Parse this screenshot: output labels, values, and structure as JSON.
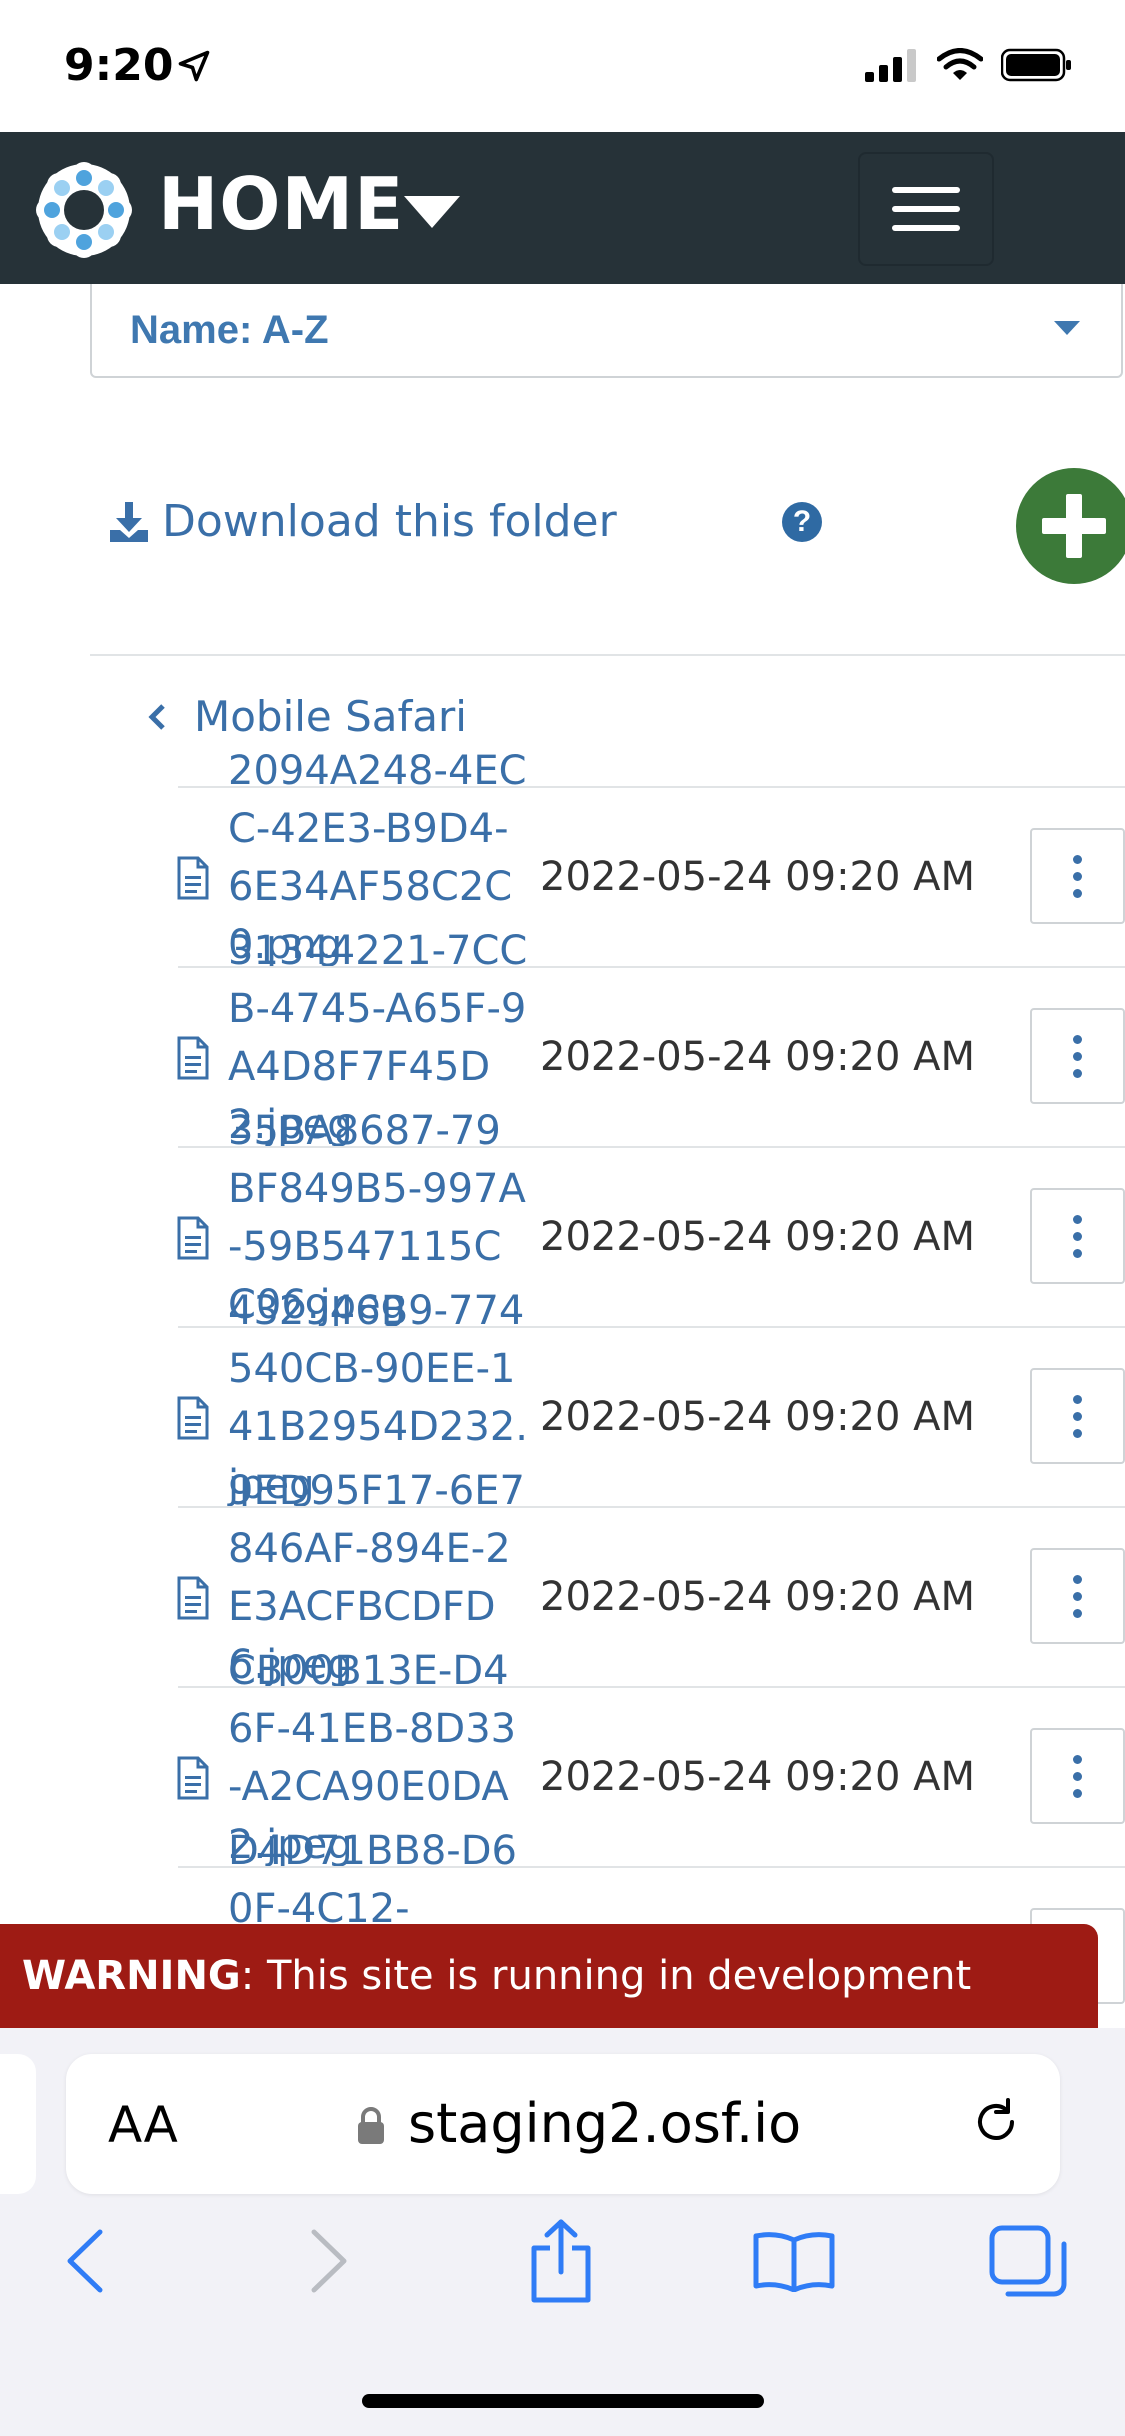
{
  "status_bar": {
    "time": "9:20"
  },
  "navbar": {
    "title": "HOME"
  },
  "sort": {
    "label": "Name: A-Z"
  },
  "actions": {
    "download_label": "Download this folder",
    "help_glyph": "?"
  },
  "breadcrumb": {
    "back_label": "Mobile Safari"
  },
  "files": [
    {
      "name": "2094A248-4ECC-42E3-B9D4-6E34AF58C2C0.png",
      "date": "2022-05-24 09:20 AM"
    },
    {
      "name": "31344221-7CCB-4745-A65F-9A4D8F7F45D2.jpeg",
      "date": "2022-05-24 09:20 AM"
    },
    {
      "name": "35BA8687-79BF849B5-997A-59B547115CC06.jpeg",
      "date": "2022-05-24 09:20 AM"
    },
    {
      "name": "432946B9-774540CB-90EE-141B2954D232.jpeg",
      "date": "2022-05-24 09:20 AM"
    },
    {
      "name": "9ED95F17-6E7846AF-894E-2E3ACFBCDFD6.jpeg",
      "date": "2022-05-24 09:20 AM"
    },
    {
      "name": "CB00B13E-D46F-41EB-8D33-A2CA90E0DA2.jpeg",
      "date": "2022-05-24 09:20 AM"
    },
    {
      "name": "D4D71BB8-D60F-4C12-",
      "date": ""
    }
  ],
  "warning": {
    "label": "WARNING",
    "message": ": This site is running in development mode."
  },
  "safari": {
    "aa_label": "AA",
    "url": "staging2.osf.io"
  },
  "colors": {
    "navbar": "#263238",
    "link": "#3a6fa8",
    "add": "#3c7a39",
    "warning": "#9e1b14"
  }
}
